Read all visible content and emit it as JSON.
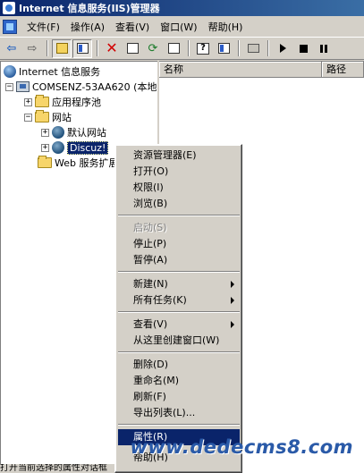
{
  "window": {
    "title": "Internet 信息服务(IIS)管理器"
  },
  "menubar": [
    "文件(F)",
    "操作(A)",
    "查看(V)",
    "窗口(W)",
    "帮助(H)"
  ],
  "toolbar": {
    "icons": [
      "back-arrow-icon",
      "forward-arrow-icon",
      "up-folder-icon",
      "show-tree-icon",
      "delete-icon",
      "properties-icon",
      "refresh-icon",
      "export-list-icon",
      "help-icon",
      "action-pane-icon",
      "computer-icon",
      "start-icon",
      "stop-icon",
      "pause-icon"
    ]
  },
  "tree": {
    "root": "Internet 信息服务",
    "computer": "COMSENZ-53AA620 (本地计",
    "app_pools": "应用程序池",
    "websites": "网站",
    "default_site": "默认网站",
    "discuz_site": "Discuz!",
    "web_ext": "Web 服务扩展"
  },
  "list": {
    "columns": [
      "名称",
      "路径"
    ]
  },
  "context_menu": {
    "items": [
      "资源管理器(E)",
      "打开(O)",
      "权限(I)",
      "浏览(B)",
      "启动(S)",
      "停止(P)",
      "暂停(A)",
      "新建(N)",
      "所有任务(K)",
      "查看(V)",
      "从这里创建窗口(W)",
      "删除(D)",
      "重命名(M)",
      "刷新(F)",
      "导出列表(L)...",
      "属性(R)",
      "帮助(H)"
    ],
    "disabled": [
      "启动(S)"
    ],
    "highlighted": "属性(R)"
  },
  "status": {
    "text": "打开当前选择的属性对话框"
  },
  "watermark": "www.dedecms8.com"
}
